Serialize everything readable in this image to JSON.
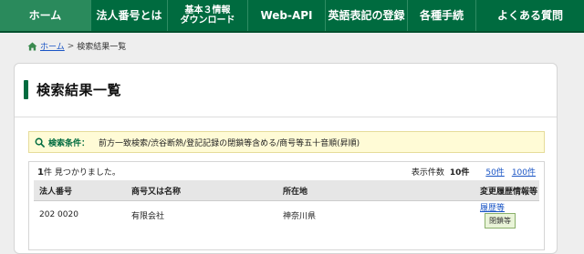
{
  "nav": {
    "items": [
      {
        "label": "ホーム",
        "active": true
      },
      {
        "label": "法人番号とは"
      },
      {
        "line1": "基本３情報",
        "line2": "ダウンロード"
      },
      {
        "label": "Web-API"
      },
      {
        "label": "英語表記の登録"
      },
      {
        "label": "各種手続"
      },
      {
        "label": "よくある質問"
      }
    ]
  },
  "breadcrumb": {
    "home": "ホーム",
    "separator": ">",
    "current": "検索結果一覧"
  },
  "page": {
    "title": "検索結果一覧"
  },
  "condition": {
    "label": "検索条件：",
    "text": "前方一致検索/渋谷断熱/登記記録の閉鎖等含める/商号等五十音順(昇順)"
  },
  "results": {
    "count_number": "1",
    "count_text": "件 見つかりました。",
    "per_page_label": "表示件数",
    "per_page_current": "10件",
    "per_page_options": [
      "50件",
      "100件"
    ],
    "columns": [
      "法人番号",
      "商号又は名称",
      "所在地",
      "変更履歴情報等"
    ],
    "rows": [
      {
        "corporate_number": "202  0020",
        "name": "有限会社",
        "address": "神奈川県",
        "history_link": "履歴等",
        "status_badge": "閉鎖等"
      }
    ]
  },
  "colors": {
    "nav_green": "#006b3f",
    "link_blue": "#1a55c5",
    "condition_bg": "#fffbd6"
  }
}
